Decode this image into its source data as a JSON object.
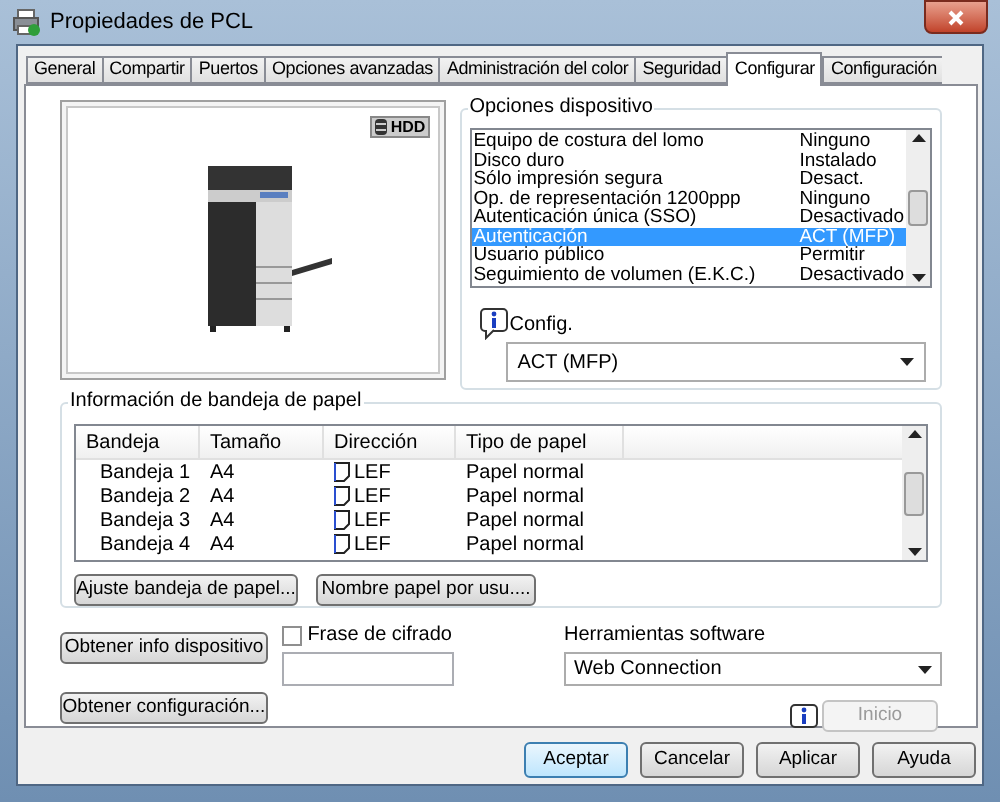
{
  "window": {
    "title": "Propiedades de PCL"
  },
  "tabs": [
    {
      "label": "General",
      "selected": false
    },
    {
      "label": "Compartir",
      "selected": false
    },
    {
      "label": "Puertos",
      "selected": false
    },
    {
      "label": "Opciones avanzadas",
      "selected": false
    },
    {
      "label": "Administración del color",
      "selected": false
    },
    {
      "label": "Seguridad",
      "selected": false
    },
    {
      "label": "Configurar",
      "selected": true
    },
    {
      "label": "Configuración",
      "selected": false
    }
  ],
  "preview": {
    "badge": "HDD"
  },
  "device_options": {
    "title": "Opciones dispositivo",
    "items": [
      {
        "name": "Equipo de costura del lomo",
        "value": "Ninguno",
        "selected": false
      },
      {
        "name": "Disco duro",
        "value": "Instalado",
        "selected": false
      },
      {
        "name": "Sólo impresión segura",
        "value": "Desact.",
        "selected": false
      },
      {
        "name": "Op. de representación 1200ppp",
        "value": "Ninguno",
        "selected": false
      },
      {
        "name": "Autenticación única (SSO)",
        "value": "Desactivado",
        "selected": false
      },
      {
        "name": "Autenticación",
        "value": "ACT (MFP)",
        "selected": true
      },
      {
        "name": "Usuario público",
        "value": "Permitir",
        "selected": false
      },
      {
        "name": "Seguimiento de volumen (E.K.C.)",
        "value": "Desactivado",
        "selected": false
      }
    ],
    "config_label": "Config.",
    "config_value": "ACT (MFP)"
  },
  "paper_tray": {
    "title": "Información de bandeja de papel",
    "columns": [
      "Bandeja",
      "Tamaño",
      "Dirección",
      "Tipo de papel"
    ],
    "rows": [
      {
        "tray": "Bandeja 1",
        "size": "A4",
        "direction": "LEF",
        "type": "Papel normal"
      },
      {
        "tray": "Bandeja 2",
        "size": "A4",
        "direction": "LEF",
        "type": "Papel normal"
      },
      {
        "tray": "Bandeja 3",
        "size": "A4",
        "direction": "LEF",
        "type": "Papel normal"
      },
      {
        "tray": "Bandeja 4",
        "size": "A4",
        "direction": "LEF",
        "type": "Papel normal"
      }
    ],
    "buttons": [
      "Ajuste bandeja de papel...",
      "Nombre papel por usu...."
    ]
  },
  "get_info_button": "Obtener info dispositivo",
  "get_config_button": "Obtener configuración...",
  "passphrase": {
    "label": "Frase de cifrado",
    "checked": false
  },
  "software_tools": {
    "label": "Herramientas software",
    "value": "Web Connection",
    "start_button": {
      "label": "Inicio",
      "disabled": true
    }
  },
  "dialog_buttons": [
    {
      "label": "Aceptar",
      "default": true
    },
    {
      "label": "Cancelar",
      "default": false
    },
    {
      "label": "Aplicar",
      "default": false
    },
    {
      "label": "Ayuda",
      "default": false
    }
  ]
}
